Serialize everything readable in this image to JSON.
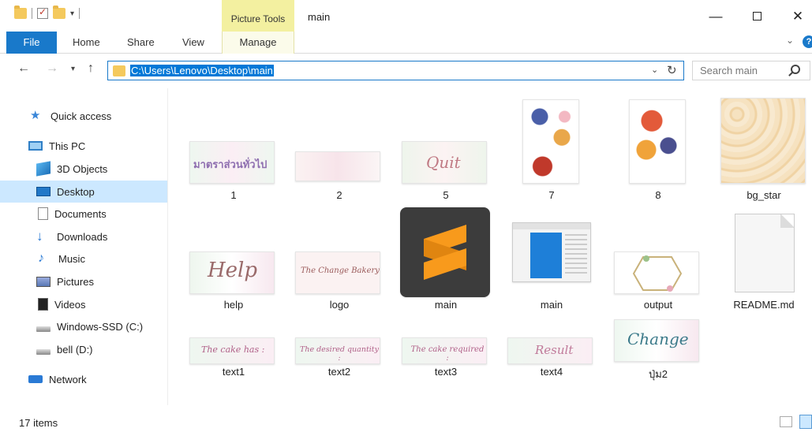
{
  "window": {
    "title": "main",
    "contextual_tab_group": "Picture Tools",
    "min_symbol": "—",
    "close_symbol": "✕"
  },
  "ribbon": {
    "tabs": [
      "File",
      "Home",
      "Share",
      "View",
      "Manage"
    ]
  },
  "address": {
    "path": "C:\\Users\\Lenovo\\Desktop\\main",
    "search_placeholder": "Search main"
  },
  "sidebar": {
    "items": [
      {
        "label": "Quick access",
        "icon": "star-icon"
      },
      {
        "label": "This PC",
        "icon": "computer-icon"
      },
      {
        "label": "3D Objects",
        "icon": "cube-icon"
      },
      {
        "label": "Desktop",
        "icon": "desktop-icon",
        "selected": true
      },
      {
        "label": "Documents",
        "icon": "document-icon"
      },
      {
        "label": "Downloads",
        "icon": "download-arrow-icon"
      },
      {
        "label": "Music",
        "icon": "music-note-icon"
      },
      {
        "label": "Pictures",
        "icon": "picture-icon"
      },
      {
        "label": "Videos",
        "icon": "film-icon"
      },
      {
        "label": "Windows-SSD (C:)",
        "icon": "drive-icon"
      },
      {
        "label": "bell (D:)",
        "icon": "drive-icon"
      },
      {
        "label": "Network",
        "icon": "network-icon"
      }
    ]
  },
  "files": [
    {
      "name": "1",
      "thumb_text": "มาตราส่วนทั่วไป"
    },
    {
      "name": "2",
      "thumb_text": ""
    },
    {
      "name": "5",
      "thumb_text": "Quit"
    },
    {
      "name": "7",
      "thumb_text": ""
    },
    {
      "name": "8",
      "thumb_text": ""
    },
    {
      "name": "bg_star",
      "thumb_text": ""
    },
    {
      "name": "help",
      "thumb_text": "Help"
    },
    {
      "name": "logo",
      "thumb_text": "The Change Bakery"
    },
    {
      "name": "main",
      "thumb_text": ""
    },
    {
      "name": "main",
      "thumb_text": ""
    },
    {
      "name": "output",
      "thumb_text": ""
    },
    {
      "name": "README.md",
      "thumb_text": ""
    },
    {
      "name": "text1",
      "thumb_text": "The cake has :"
    },
    {
      "name": "text2",
      "thumb_text": "The desired quantity :"
    },
    {
      "name": "text3",
      "thumb_text": "The cake required :"
    },
    {
      "name": "text4",
      "thumb_text": "Result"
    },
    {
      "name": "ปุ่ม2",
      "thumb_text": "Change"
    }
  ],
  "status": {
    "item_count": "17 items"
  }
}
